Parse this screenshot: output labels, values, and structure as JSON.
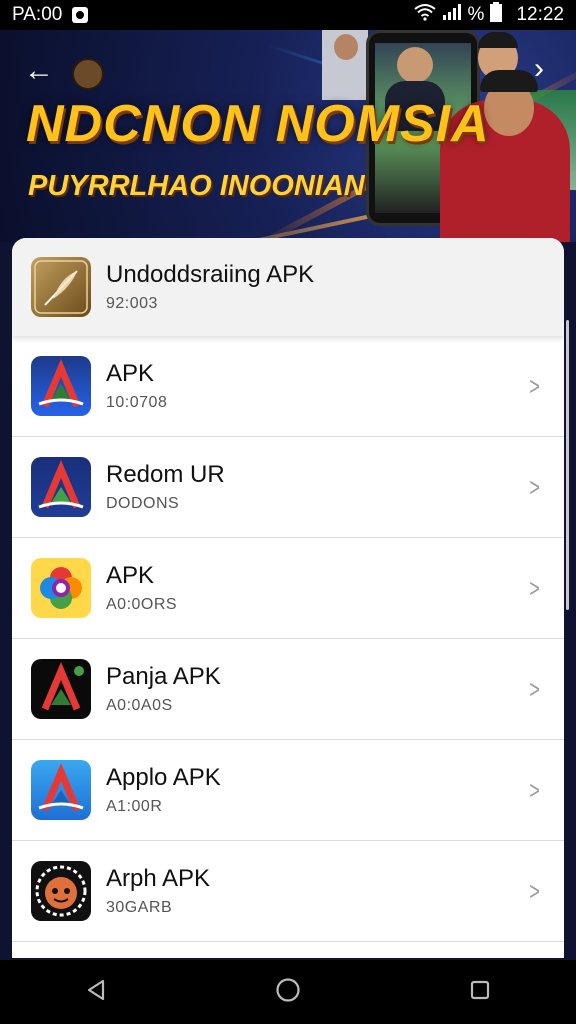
{
  "status_bar": {
    "left_text": "PA:00",
    "signal_text": "%",
    "time": "12:22"
  },
  "banner": {
    "title": "NDCNON NOMSIA",
    "subtitle": "PUYRRLHAO INOONIAN"
  },
  "list": {
    "items": [
      {
        "title": "Undoddsraiing APK",
        "subtitle": "92:003",
        "icon": "feather-icon"
      },
      {
        "title": "APK",
        "subtitle": "10:0708",
        "icon": "a-logo-icon"
      },
      {
        "title": "Redom UR",
        "subtitle": "DODONS",
        "icon": "a-logo-icon"
      },
      {
        "title": "APK",
        "subtitle": "A0:0ORS",
        "icon": "flower-icon"
      },
      {
        "title": "Panja APK",
        "subtitle": "A0:0A0S",
        "icon": "a-logo-icon"
      },
      {
        "title": "Applo APK",
        "subtitle": "A1:00R",
        "icon": "a-logo-icon"
      },
      {
        "title": "Arph APK",
        "subtitle": "30GARB",
        "icon": "face-icon"
      }
    ]
  },
  "colors": {
    "banner_title": "#ffc21a",
    "list_background": "#ffffff",
    "header_row": "#f2f2f3"
  }
}
